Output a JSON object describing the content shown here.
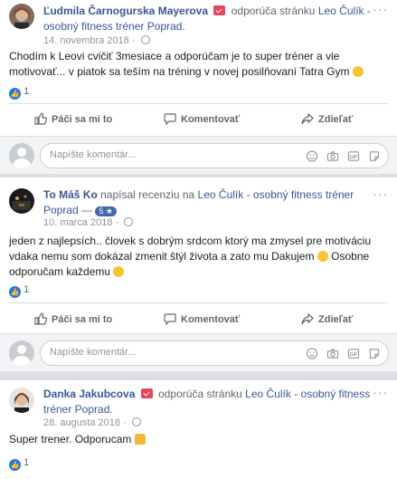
{
  "posts": [
    {
      "author": "Ľudmila Čarnogurska Mayerova",
      "verb": "odporúča stránku",
      "page": "Leo Čulík - osobný fitness tréner Poprad.",
      "date": "14. novembra 2018",
      "text": "Chodím k Leovi cvičiť 3mesiace a odporúčam je to super tréner a vie motivovať... v piatok sa teším na tréning v novej posilňovaní Tatra Gym",
      "reactions": "1"
    },
    {
      "author": "To Máš Ko",
      "verb": "napísal recenziu na",
      "page": "Leo Čulík - osobný fitness tréner Poprad",
      "rating": "5",
      "date": "10. marca 2018",
      "text_1": "jeden z najlepsích.. človek s dobrým srdcom ktorý ma zmysel pre motiváciu vdaka nemu som dokázal zmenit štýl života a zato mu Dakujem",
      "text_2": "Osobne odporučam každemu",
      "reactions": "1"
    },
    {
      "author": "Danka Jakubcova",
      "verb": "odporúča stránku",
      "page": "Leo Čulík - osobný fitness tréner Poprad.",
      "date": "28. augusta 2018",
      "text": "Super trener. Odporucam",
      "reactions": "1"
    }
  ],
  "actions": {
    "like": "Páči sa mi to",
    "comment": "Komentovať",
    "share": "Zdieľať"
  },
  "comment_placeholder": "Napíšte komentár...",
  "more_label": "···",
  "icons": [
    "globe-icon",
    "recommend-icon",
    "like-icon",
    "comment-icon",
    "share-icon",
    "emoji-icon",
    "camera-icon",
    "gif-icon",
    "sticker-icon",
    "more-icon"
  ],
  "colors": {
    "link": "#385898",
    "like_blue": "#2078f4",
    "recommend_red": "#e4475d",
    "muted": "#606770"
  }
}
